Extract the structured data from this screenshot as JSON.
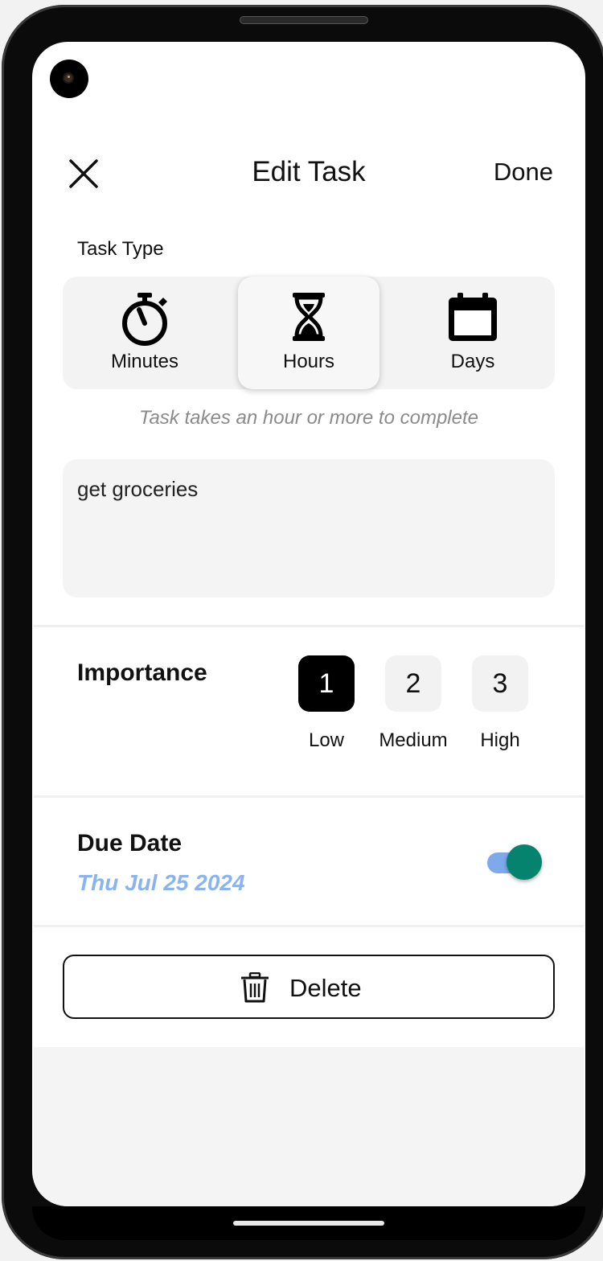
{
  "header": {
    "title": "Edit Task",
    "done_label": "Done"
  },
  "task_type": {
    "label": "Task Type",
    "options": [
      {
        "label": "Minutes",
        "icon": "stopwatch-icon"
      },
      {
        "label": "Hours",
        "icon": "hourglass-icon"
      },
      {
        "label": "Days",
        "icon": "calendar-icon"
      }
    ],
    "selected": "Hours",
    "hint": "Task takes an hour or more to complete"
  },
  "task_input": {
    "value": "get groceries"
  },
  "importance": {
    "label": "Importance",
    "levels": [
      {
        "value": "1",
        "label": "Low"
      },
      {
        "value": "2",
        "label": "Medium"
      },
      {
        "value": "3",
        "label": "High"
      }
    ],
    "selected": "1"
  },
  "due_date": {
    "label": "Due Date",
    "value": "Thu Jul 25 2024",
    "enabled": true
  },
  "delete": {
    "label": "Delete"
  },
  "colors": {
    "accent_date": "#8ab4ee",
    "toggle_thumb": "#05836f",
    "toggle_track": "#7ea9ea"
  }
}
